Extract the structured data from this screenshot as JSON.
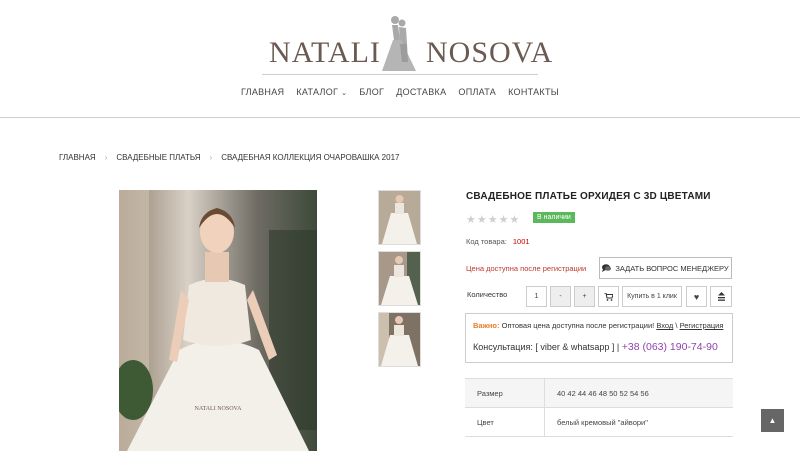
{
  "brand": {
    "left": "NATALI",
    "right": "NOSOVA"
  },
  "nav": [
    {
      "label": "ГЛАВНАЯ"
    },
    {
      "label": "КАТАЛОГ"
    },
    {
      "label": "БЛОГ"
    },
    {
      "label": "ДОСТАВКА"
    },
    {
      "label": "ОПЛАТА"
    },
    {
      "label": "КОНТАКТЫ"
    }
  ],
  "breadcrumb": [
    "ГЛАВНАЯ",
    "СВАДЕБНЫЕ ПЛАТЬЯ",
    "СВАДЕБНАЯ КОЛЛЕКЦИЯ ОЧАРОВАШКА 2017"
  ],
  "product": {
    "title": "СВАДЕБНОЕ ПЛАТЬЕ ОРХИДЕЯ С 3D ЦВЕТАМИ",
    "stock_badge": "В наличии",
    "code_label": "Код товара:",
    "code_value": "1001",
    "price_note": "Цена доступна после регистрации",
    "ask_manager": "ЗАДАТЬ ВОПРОС МЕНЕДЖЕРУ",
    "qty_label": "Количество",
    "qty_value": "1",
    "qty_minus": "-",
    "qty_plus": "+",
    "buy_one_click": "Купить в 1 клик",
    "photo_watermark": "NATALI NOSOVA"
  },
  "info": {
    "warn": "Важно:",
    "text": "Оптовая цена доступна после регистрации!",
    "login": "Вход",
    "sep": "\\",
    "register": "Регистрация",
    "consult_label": "Консультация: [ viber & whatsapp ] |",
    "phone": "+38 (063) 190-74-90"
  },
  "specs": [
    {
      "key": "Размер",
      "value": "40 42 44 46 48 50 52 54 56"
    },
    {
      "key": "Цвет",
      "value": "белый кремовый \"айвори\""
    }
  ],
  "colors": {
    "accent": "#8e44ad",
    "badge": "#5cb85c",
    "warn": "#e67e22",
    "price_note": "#c0392b"
  }
}
